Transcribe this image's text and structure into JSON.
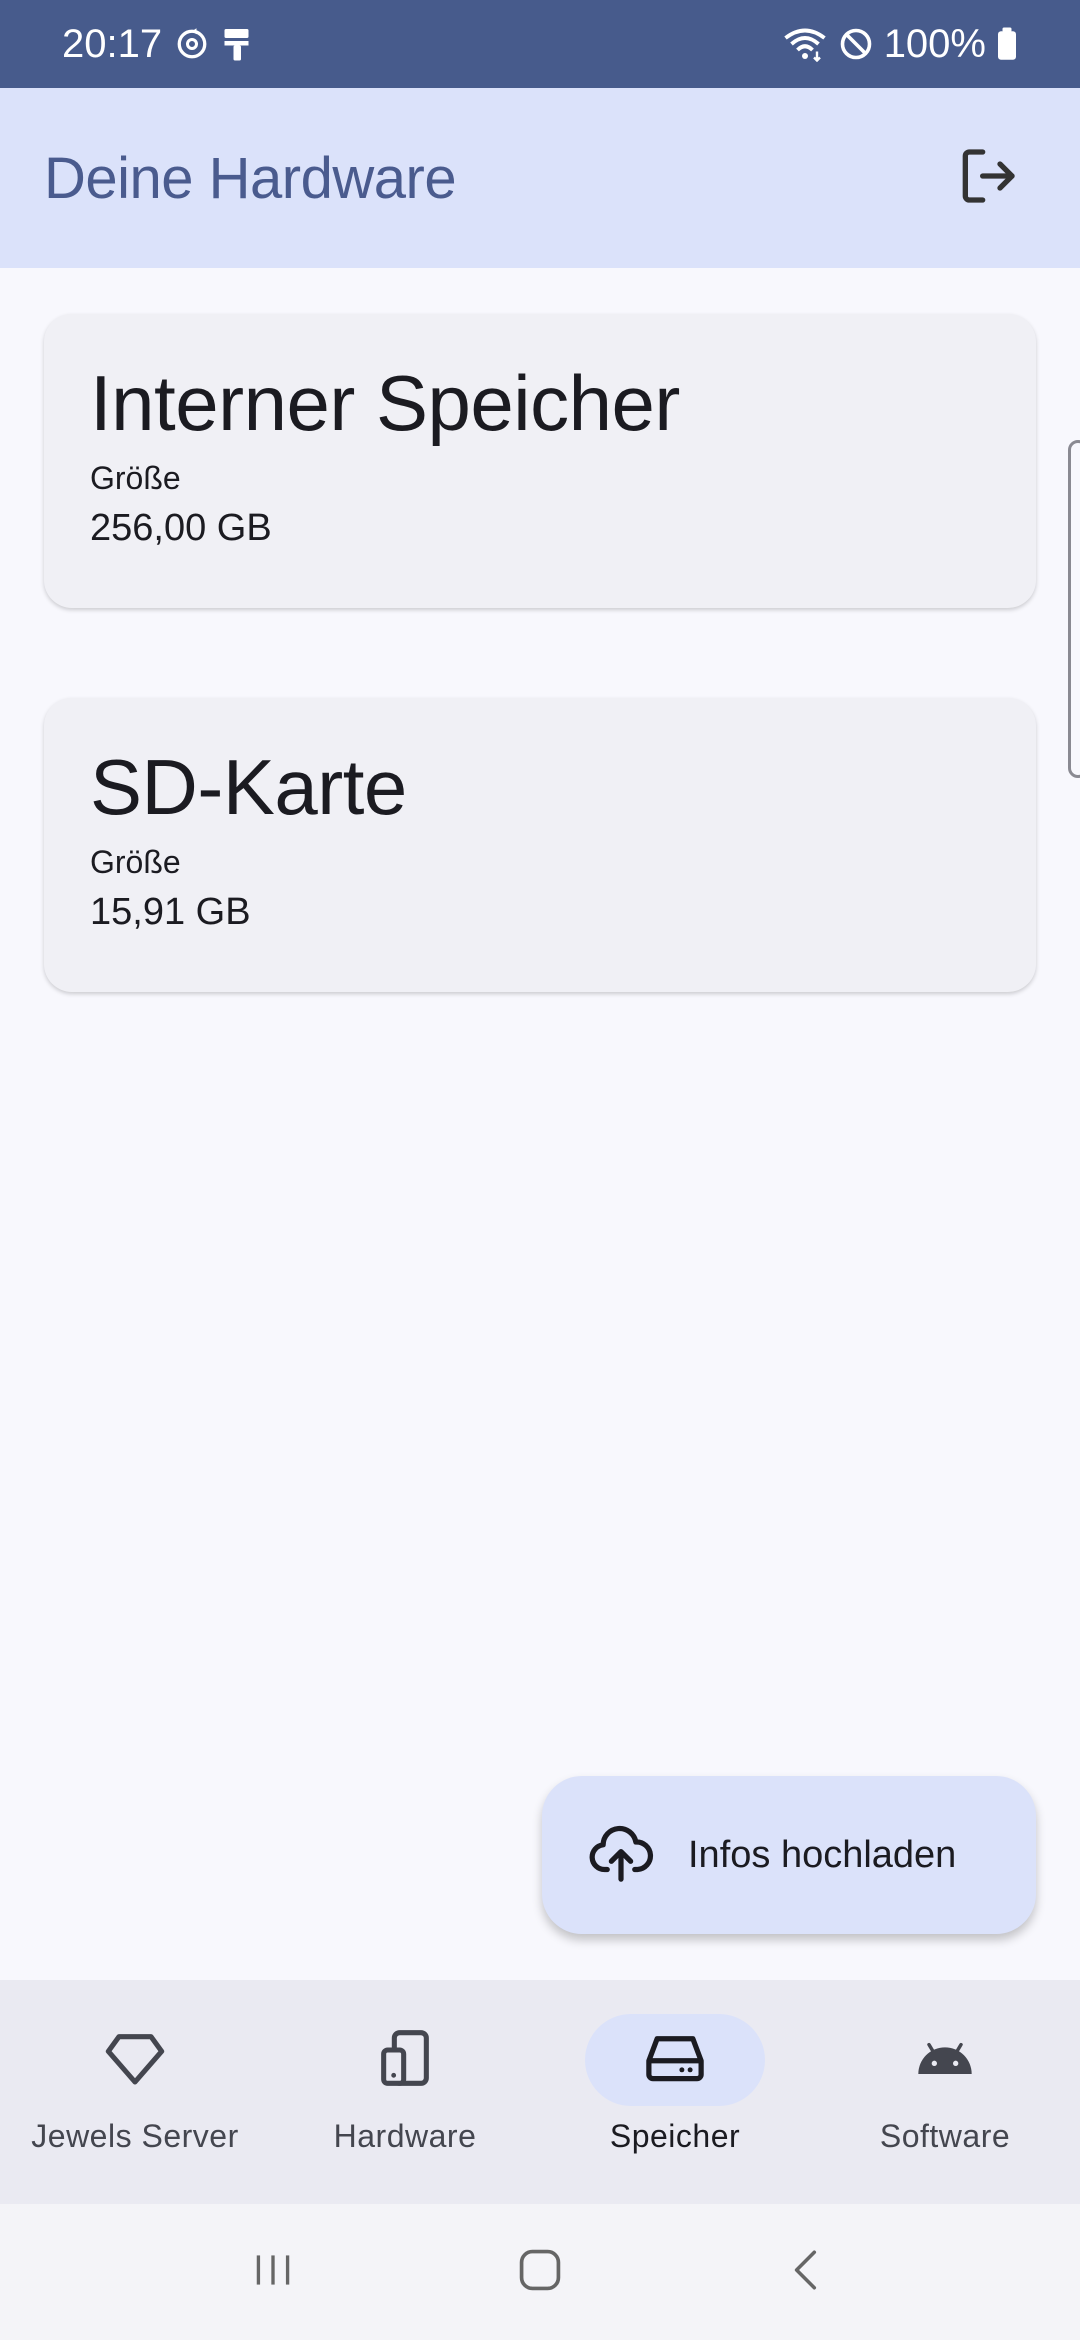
{
  "status_bar": {
    "time": "20:17",
    "battery": "100%",
    "icons": [
      "sync-icon",
      "paint-roller-icon",
      "wifi-icon",
      "do-not-disturb-icon",
      "battery-icon"
    ]
  },
  "app_bar": {
    "title": "Deine Hardware",
    "logout_icon": "logout-icon"
  },
  "storage_cards": [
    {
      "title": "Interner Speicher",
      "size_label": "Größe",
      "size_value": "256,00 GB"
    },
    {
      "title": "SD-Karte",
      "size_label": "Größe",
      "size_value": "15,91 GB"
    }
  ],
  "fab": {
    "label": "Infos hochladen",
    "icon": "cloud-upload-icon"
  },
  "bottom_nav": {
    "items": [
      {
        "label": "Jewels Server",
        "icon": "diamond-icon",
        "active": false
      },
      {
        "label": "Hardware",
        "icon": "devices-icon",
        "active": false
      },
      {
        "label": "Speicher",
        "icon": "hard-drive-icon",
        "active": true
      },
      {
        "label": "Software",
        "icon": "android-icon",
        "active": false
      }
    ]
  },
  "colors": {
    "status_bar": "#475b8c",
    "app_bar": "#dbe2fa",
    "title": "#4a5b8e",
    "background": "#f8f8fd",
    "card": "#f0f0f5",
    "nav_bar": "#eaeaf2"
  }
}
